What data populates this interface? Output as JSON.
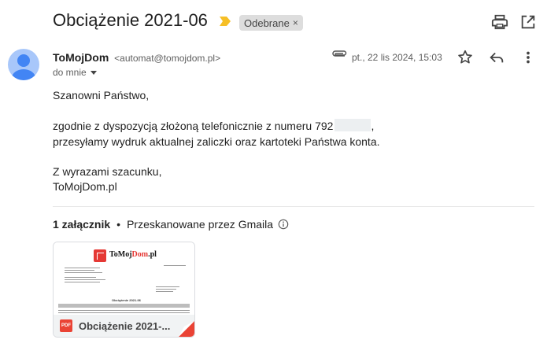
{
  "header": {
    "subject": "Obciążenie 2021-06",
    "label": "Odebrane",
    "label_close": "×"
  },
  "sender": {
    "name": "ToMojDom",
    "email": "<automat@tomojdom.pl>",
    "to": "do mnie",
    "date": "pt., 22 lis 2024, 15:03"
  },
  "body": {
    "greeting": "Szanowni Państwo,",
    "line1_prefix": "zgodnie z dyspozycją złożoną telefonicznie z numeru 792",
    "line1_suffix": ",",
    "line2": "przesyłamy wydruk aktualnej zaliczki oraz kartoteki Państwa konta.",
    "closing": "Z wyrazami szacunku,",
    "signature": "ToMojDom.pl"
  },
  "attachments": {
    "count_label": "1 załącznik",
    "dot": "•",
    "scanned": "Przeskanowane przez Gmaila",
    "file": {
      "type": "PDF",
      "name": "Obciążenie 2021-...",
      "preview_logo_prefix": "ToMoj",
      "preview_logo_mid": "Dom",
      "preview_logo_suffix": ".pl",
      "preview_title": "Obciążenie 2021-06"
    }
  },
  "icons": {
    "importance": "importance-marker-icon",
    "print": "print-icon",
    "new_window": "open-in-new-window-icon",
    "attachment": "paperclip-icon",
    "star": "star-icon",
    "reply": "reply-icon",
    "more": "more-vert-icon",
    "info": "info-icon",
    "dropdown": "caret-down-icon"
  },
  "colors": {
    "importance": "#f6bf26",
    "label_bg": "#dddddd",
    "avatar_bg": "#a8c7fa",
    "avatar_fg": "#4285f4",
    "pdf_red": "#ea4335",
    "brand_red": "#e53935"
  }
}
